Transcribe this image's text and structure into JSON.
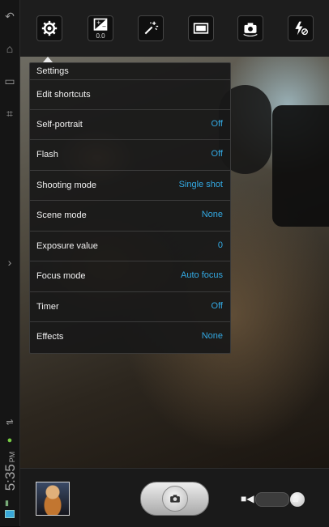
{
  "toolbar": {
    "buttons": [
      {
        "icon": "gear-icon"
      },
      {
        "icon": "exposure-icon",
        "value": "0.0"
      },
      {
        "icon": "magic-wand-icon"
      },
      {
        "icon": "screen-mode-icon"
      },
      {
        "icon": "switch-camera-icon"
      },
      {
        "icon": "flash-off-icon"
      }
    ]
  },
  "status": {
    "time": "5:35",
    "ampm": "PM"
  },
  "menu": {
    "title": "Settings",
    "items": [
      {
        "label": "Edit shortcuts",
        "value": ""
      },
      {
        "label": "Self-portrait",
        "value": "Off"
      },
      {
        "label": "Flash",
        "value": "Off"
      },
      {
        "label": "Shooting mode",
        "value": "Single shot"
      },
      {
        "label": "Scene mode",
        "value": "None"
      },
      {
        "label": "Exposure value",
        "value": "0"
      },
      {
        "label": "Focus mode",
        "value": "Auto focus"
      },
      {
        "label": "Timer",
        "value": "Off"
      },
      {
        "label": "Effects",
        "value": "None"
      }
    ]
  },
  "colors": {
    "accent": "#33a9e3",
    "menu_bg": "#181818"
  }
}
